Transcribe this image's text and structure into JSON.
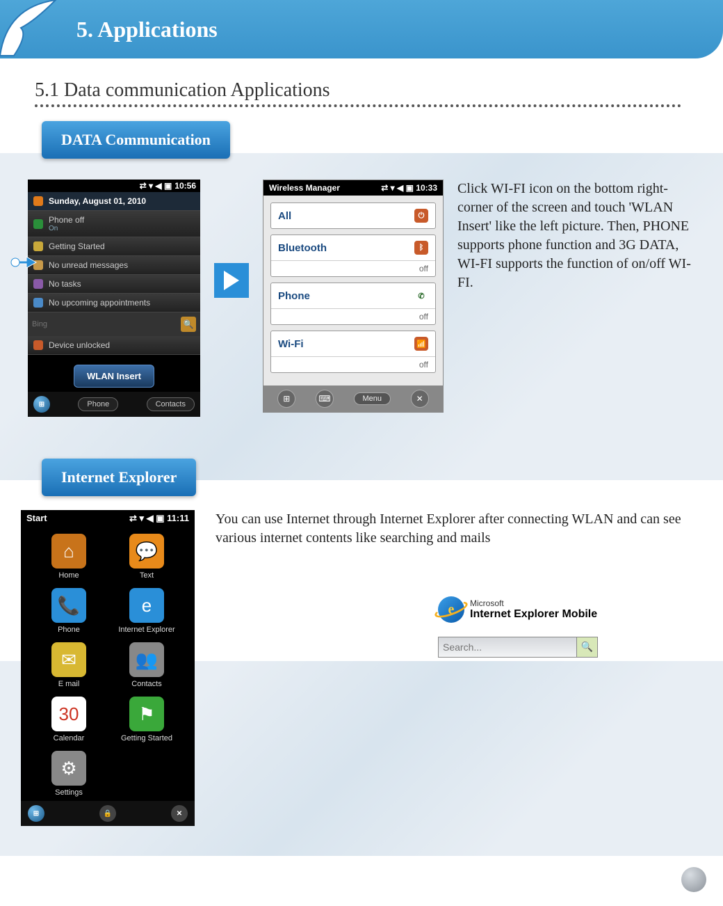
{
  "header": {
    "title": "5. Applications"
  },
  "section": {
    "title": "5.1 Data communication Applications"
  },
  "pill1": "DATA Communication",
  "phone1": {
    "time": "10:56",
    "date": "Sunday, August 01, 2010",
    "phone_label": "Phone off",
    "phone_sub": "On",
    "rows": [
      "Getting Started",
      "No unread messages",
      "No tasks",
      "No upcoming appointments"
    ],
    "bing_placeholder": "Bing",
    "unlocked": "Device unlocked",
    "wlan_btn": "WLAN Insert",
    "soft_left": "Phone",
    "soft_right": "Contacts"
  },
  "wm": {
    "title": "Wireless Manager",
    "time": "10:33",
    "all": "All",
    "items": [
      {
        "label": "Bluetooth",
        "state": "off"
      },
      {
        "label": "Phone",
        "state": "off"
      },
      {
        "label": "Wi-Fi",
        "state": "off"
      }
    ],
    "menu": "Menu"
  },
  "desc1": "Click WI-FI icon on the bottom right-corner of the screen and touch 'WLAN Insert' like the left picture. Then, PHONE supports phone function and 3G DATA, WI-FI supports the function of on/off WI-FI.",
  "pill2": "Internet Explorer",
  "desc2": "You can use Internet through Internet Explorer after connecting WLAN and can see various internet contents like searching and mails",
  "start": {
    "title": "Start",
    "time": "11:11",
    "apps": [
      {
        "label": "Home",
        "glyph": "⌂",
        "bg": "#c8731a"
      },
      {
        "label": "Text",
        "glyph": "💬",
        "bg": "#e88a1a"
      },
      {
        "label": "",
        "glyph": "📞",
        "bg": "#2a8fd8"
      },
      {
        "label": "Phone",
        "glyph": "",
        "bg": "transparent"
      },
      {
        "label": "E mail",
        "glyph": "✉",
        "bg": "#d8b832"
      },
      {
        "label": "Internet Explorer",
        "glyph": "e",
        "bg": "#2a8fd8"
      },
      {
        "label": "",
        "glyph": "👥",
        "bg": "#888"
      },
      {
        "label": "Contacts",
        "glyph": "",
        "bg": "transparent"
      },
      {
        "label": "Calendar",
        "glyph": "30",
        "bg": "#fff"
      },
      {
        "label": "Getting Started",
        "glyph": "⚑",
        "bg": "#3aa83a"
      },
      {
        "label": "",
        "glyph": "⚙",
        "bg": "#888"
      },
      {
        "label": "Settings",
        "glyph": "",
        "bg": "transparent"
      }
    ]
  },
  "ie": {
    "small": "Microsoft",
    "big": "Internet Explorer Mobile",
    "search_placeholder": "Search..."
  }
}
